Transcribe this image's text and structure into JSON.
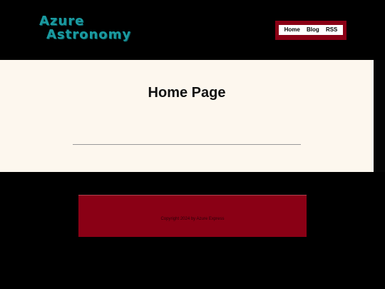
{
  "site": {
    "logo_line1": "Azure",
    "logo_line2": "Astronomy"
  },
  "nav": {
    "items": [
      {
        "label": "Home"
      },
      {
        "label": "Blog"
      },
      {
        "label": "RSS"
      }
    ]
  },
  "main": {
    "title": "Home Page"
  },
  "footer": {
    "copyright": "Copyright 2024 by Azure Express"
  },
  "colors": {
    "background": "#000000",
    "logo": "#1a9aa0",
    "accent": "#8a0015",
    "content_bg": "#fdf7ee"
  }
}
